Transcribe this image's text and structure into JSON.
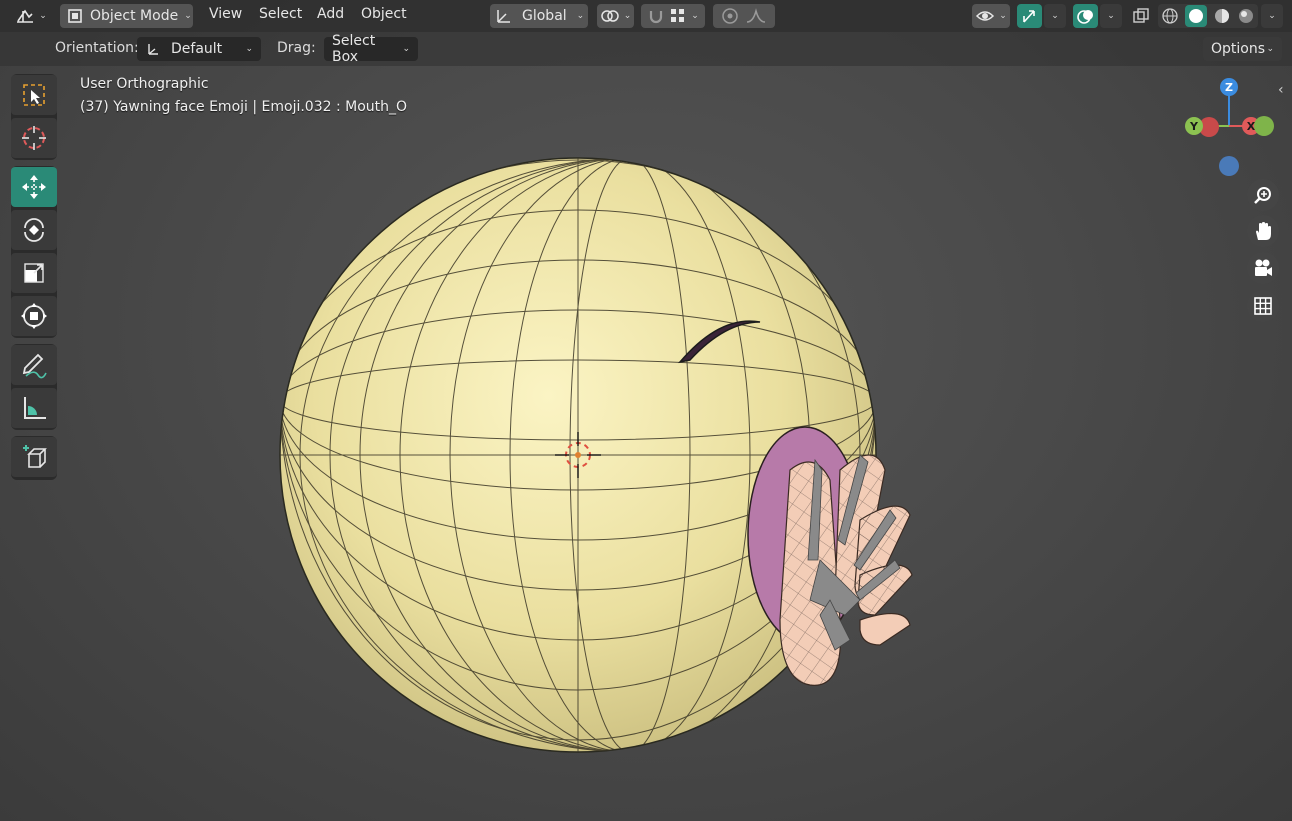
{
  "header": {
    "mode": "Object Mode",
    "menus": [
      "View",
      "Select",
      "Add",
      "Object"
    ],
    "transform_orientation": "Global",
    "options_label": "Options"
  },
  "tool_settings": {
    "orientation_label": "Orientation:",
    "orientation_value": "Default",
    "drag_label": "Drag:",
    "drag_value": "Select Box"
  },
  "viewport": {
    "view_name": "User Orthographic",
    "object_info": "(37) Yawning face Emoji | Emoji.032 : Mouth_O"
  },
  "gizmo": {
    "z": "Z",
    "y": "Y",
    "x": "X"
  },
  "icons": {
    "editor_type": "editor-type-icon",
    "tools": [
      "select-box-icon",
      "cursor-icon",
      "move-icon",
      "rotate-icon",
      "scale-icon",
      "transform-icon",
      "annotate-icon",
      "measure-icon",
      "add-cube-icon"
    ],
    "nav": [
      "zoom-icon",
      "pan-hand-icon",
      "camera-icon",
      "grid-icon"
    ]
  },
  "colors": {
    "accent": "#2a8a77",
    "header_bg": "#303030",
    "sphere": "#efe6a7",
    "mouth": "#b77aa9",
    "hand": "#f3cdb7",
    "axis_x": "#e05a5a",
    "axis_y": "#8cc251",
    "axis_z": "#3b8ce0"
  }
}
